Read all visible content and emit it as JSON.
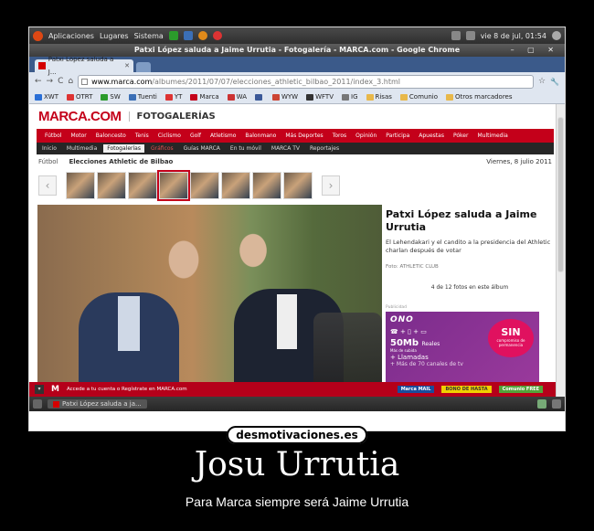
{
  "system_panel": {
    "menu_items": [
      "Aplicaciones",
      "Lugares",
      "Sistema"
    ],
    "clock": "vie  8 de jul, 01:54"
  },
  "window": {
    "title": "Patxi López saluda a Jaime Urrutia - Fotogalería - MARCA.com - Google Chrome",
    "controls": "– ▢ ✕"
  },
  "tabs": [
    {
      "label": "Patxi López saluda a J..."
    }
  ],
  "toolbar": {
    "back": "←",
    "forward": "→",
    "reload": "C",
    "home": "⌂",
    "url_host": "www.marca.com",
    "url_path": "/albumes/2011/07/07/elecciones_athletic_bilbao_2011/index_3.html",
    "star": "☆",
    "wrench": "🔧"
  },
  "bookmarks": [
    {
      "label": "XWT",
      "color": "#2a6fd6"
    },
    {
      "label": "OTRT",
      "color": "#d33"
    },
    {
      "label": "SW",
      "color": "#2b9b2b"
    },
    {
      "label": "Tuenti",
      "color": "#3b6fb6"
    },
    {
      "label": "YT",
      "color": "#d33"
    },
    {
      "label": "Marca",
      "color": "#c4001a"
    },
    {
      "label": "WA",
      "color": "#c33"
    },
    {
      "label": "",
      "color": "#3b5998"
    },
    {
      "label": "WYW",
      "color": "#c43"
    },
    {
      "label": "WFTV",
      "color": "#333"
    },
    {
      "label": "IG",
      "color": "#777"
    },
    {
      "label": "Risas",
      "color": "#e8b84a"
    },
    {
      "label": "Comunio",
      "color": "#e8b84a"
    },
    {
      "label": "Otros marcadores",
      "color": "#e8b84a"
    }
  ],
  "page": {
    "logo": "MARCA.COM",
    "section": "FOTOGALERÍAS",
    "main_nav": [
      "Fútbol",
      "Motor",
      "Baloncesto",
      "Tenis",
      "Ciclismo",
      "Golf",
      "Atletismo",
      "Balonmano",
      "Más Deportes",
      "Toros",
      "Opinión",
      "Participa",
      "Apuestas",
      "Póker",
      "Multimedia"
    ],
    "sub_nav": [
      {
        "label": "Inicio",
        "state": "normal"
      },
      {
        "label": "Multimedia",
        "state": "normal"
      },
      {
        "label": "Fotogalerías",
        "state": "active"
      },
      {
        "label": "Gráficos",
        "state": "red"
      },
      {
        "label": "Guías MARCA",
        "state": "normal"
      },
      {
        "label": "En tu móvil",
        "state": "normal"
      },
      {
        "label": "MARCA TV",
        "state": "normal"
      },
      {
        "label": "Reportajes",
        "state": "normal"
      }
    ],
    "breadcrumb_section": "Fútbol",
    "gallery_name": "Elecciones Athletic de Bilbao",
    "date": "Viernes, 8 julio 2011",
    "prev": "‹",
    "next": "›",
    "thumb_count": 8,
    "selected_thumb": 3,
    "article_title": "Patxi López saluda a Jaime Urrutia",
    "article_summary": "El Lehendakari y el candito a la presidencia del Athletic charlan después de votar",
    "photo_credit": "Foto: ATHLETIC CLUB",
    "photo_counter": "4 de 12 fotos en este álbum",
    "ad": {
      "label": "Publicidad",
      "brand": "ONO",
      "icons": "☎ + ▯ + ▭",
      "speed": "50Mb",
      "speed_unit": "Reales",
      "speed_note": "Más de subida",
      "calls": "+ Llamadas",
      "extra": "+ Más de 70 canales de tv",
      "badge_big": "SIN",
      "badge_small": "compromiso de permanencia"
    },
    "bottom_bar": {
      "logo": "M",
      "text": "Accede a tu cuenta o Regístrate en MARCA.com",
      "btn_mail": "Marca MAIL",
      "btn_bonus": "BONO DE HASTA",
      "btn_extra": "Comunio FREE"
    }
  },
  "taskbar": {
    "task": "Patxi López saluda a ja..."
  },
  "poster": {
    "site": "desmotivaciones.es",
    "title": "Josu Urrutia",
    "subtitle": "Para Marca siempre será Jaime Urrutia"
  }
}
